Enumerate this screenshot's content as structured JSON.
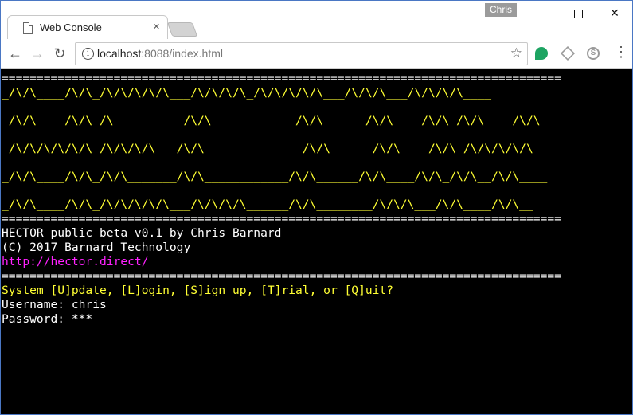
{
  "browser": {
    "tab_title": "Web Console",
    "user_badge": "Chris",
    "url_host": "localhost",
    "url_rest": ":8088/index.html"
  },
  "console": {
    "rule": "================================================================================",
    "banner": [
      "_/\\/\\____/\\/\\_/\\/\\/\\/\\/\\___/\\/\\/\\/\\_/\\/\\/\\/\\/\\___/\\/\\/\\___/\\/\\/\\/\\____",
      "_/\\/\\____/\\/\\_/\\__________/\\/\\____________/\\/\\______/\\/\\____/\\/\\_/\\/\\____/\\/\\__",
      "_/\\/\\/\\/\\/\\/\\_/\\/\\/\\/\\___/\\/\\______________/\\/\\______/\\/\\____/\\/\\_/\\/\\/\\/\\/\\____",
      "_/\\/\\____/\\/\\_/\\/\\_______/\\/\\____________/\\/\\______/\\/\\____/\\/\\_/\\/\\__/\\/\\____",
      "_/\\/\\____/\\/\\_/\\/\\/\\/\\/\\___/\\/\\/\\/\\______/\\/\\________/\\/\\/\\___/\\/\\____/\\/\\__"
    ],
    "title_line": "HECTOR public beta v0.1 by Chris Barnard",
    "copyright_line": "(C) 2017 Barnard Technology",
    "link_line": "http://hector.direct/",
    "prompt_line": "System [U]pdate, [L]ogin, [S]ign up, [T]rial, or [Q]uit?",
    "username_line": "Username: chris",
    "password_line": "Password: ***"
  },
  "colors": {
    "banner": "#ffff33",
    "link": "#ff22ff",
    "prompt": "#ffff33",
    "background": "#000000"
  },
  "icons": [
    "page-icon",
    "close-icon",
    "back-arrow-icon",
    "forward-arrow-icon",
    "reload-icon",
    "info-icon",
    "star-icon",
    "extension-green-icon",
    "extension-box-icon",
    "skype-icon",
    "menu-dots-icon"
  ]
}
